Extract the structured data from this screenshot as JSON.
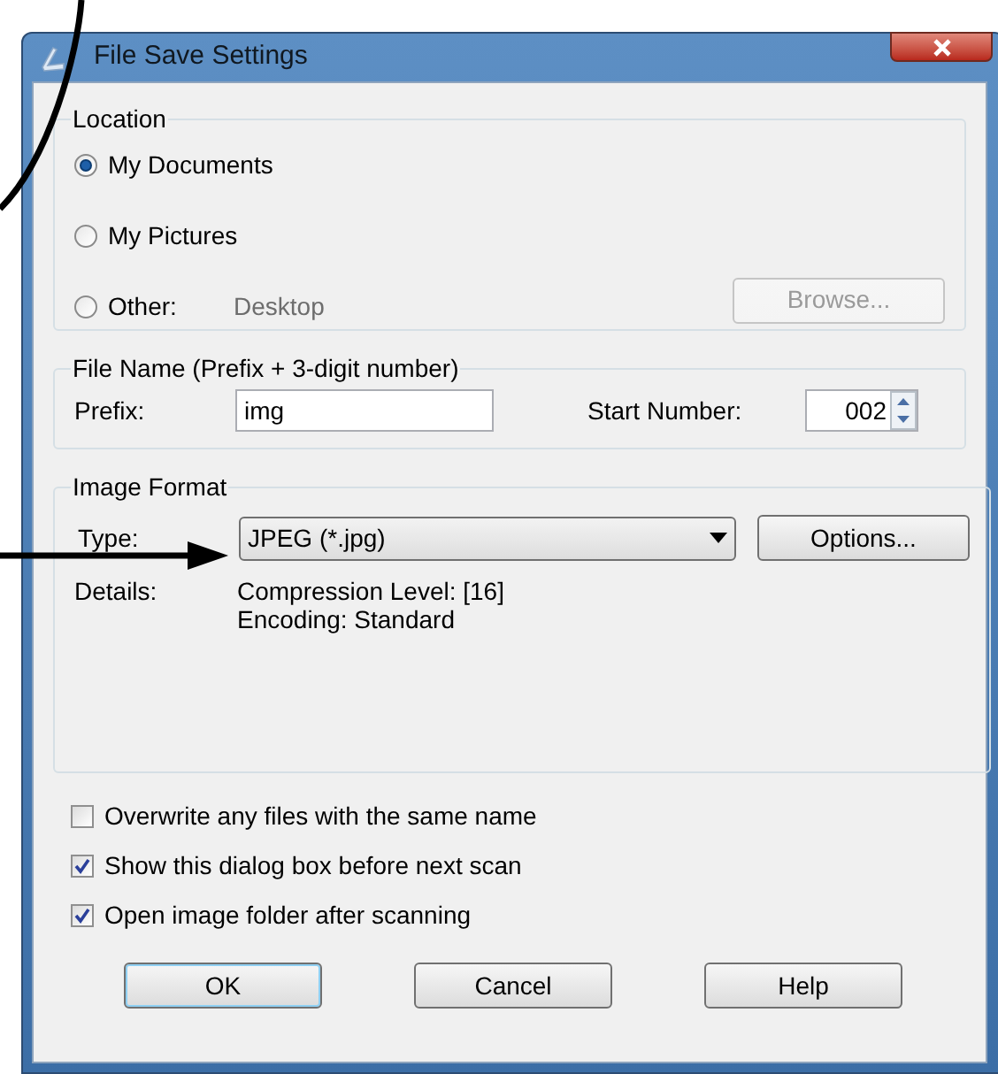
{
  "window": {
    "title": "File Save Settings"
  },
  "location": {
    "label": "Location",
    "options": [
      {
        "label": "My Documents",
        "selected": true
      },
      {
        "label": "My Pictures",
        "selected": false
      },
      {
        "label": "Other:",
        "selected": false
      }
    ],
    "other_path": "Desktop",
    "browse": {
      "label": "Browse...",
      "disabled": true
    }
  },
  "file_name": {
    "label": "File Name (Prefix + 3-digit number)",
    "prefix_label": "Prefix:",
    "prefix": "img",
    "start_label": "Start Number:",
    "start_number": "002"
  },
  "image_format": {
    "label": "Image Format",
    "type_label": "Type:",
    "type": "JPEG (*.jpg)",
    "options_button": "Options...",
    "details_label": "Details:",
    "details": [
      "Compression Level: [16]",
      "Encoding: Standard"
    ]
  },
  "checkboxes": [
    {
      "label": "Overwrite any files with the same name",
      "checked": false
    },
    {
      "label": "Show this dialog box before next scan",
      "checked": true
    },
    {
      "label": "Open image folder after scanning",
      "checked": true
    }
  ],
  "buttons": [
    {
      "label": "OK",
      "default": true
    },
    {
      "label": "Cancel",
      "default": false
    },
    {
      "label": "Help",
      "default": false
    }
  ]
}
